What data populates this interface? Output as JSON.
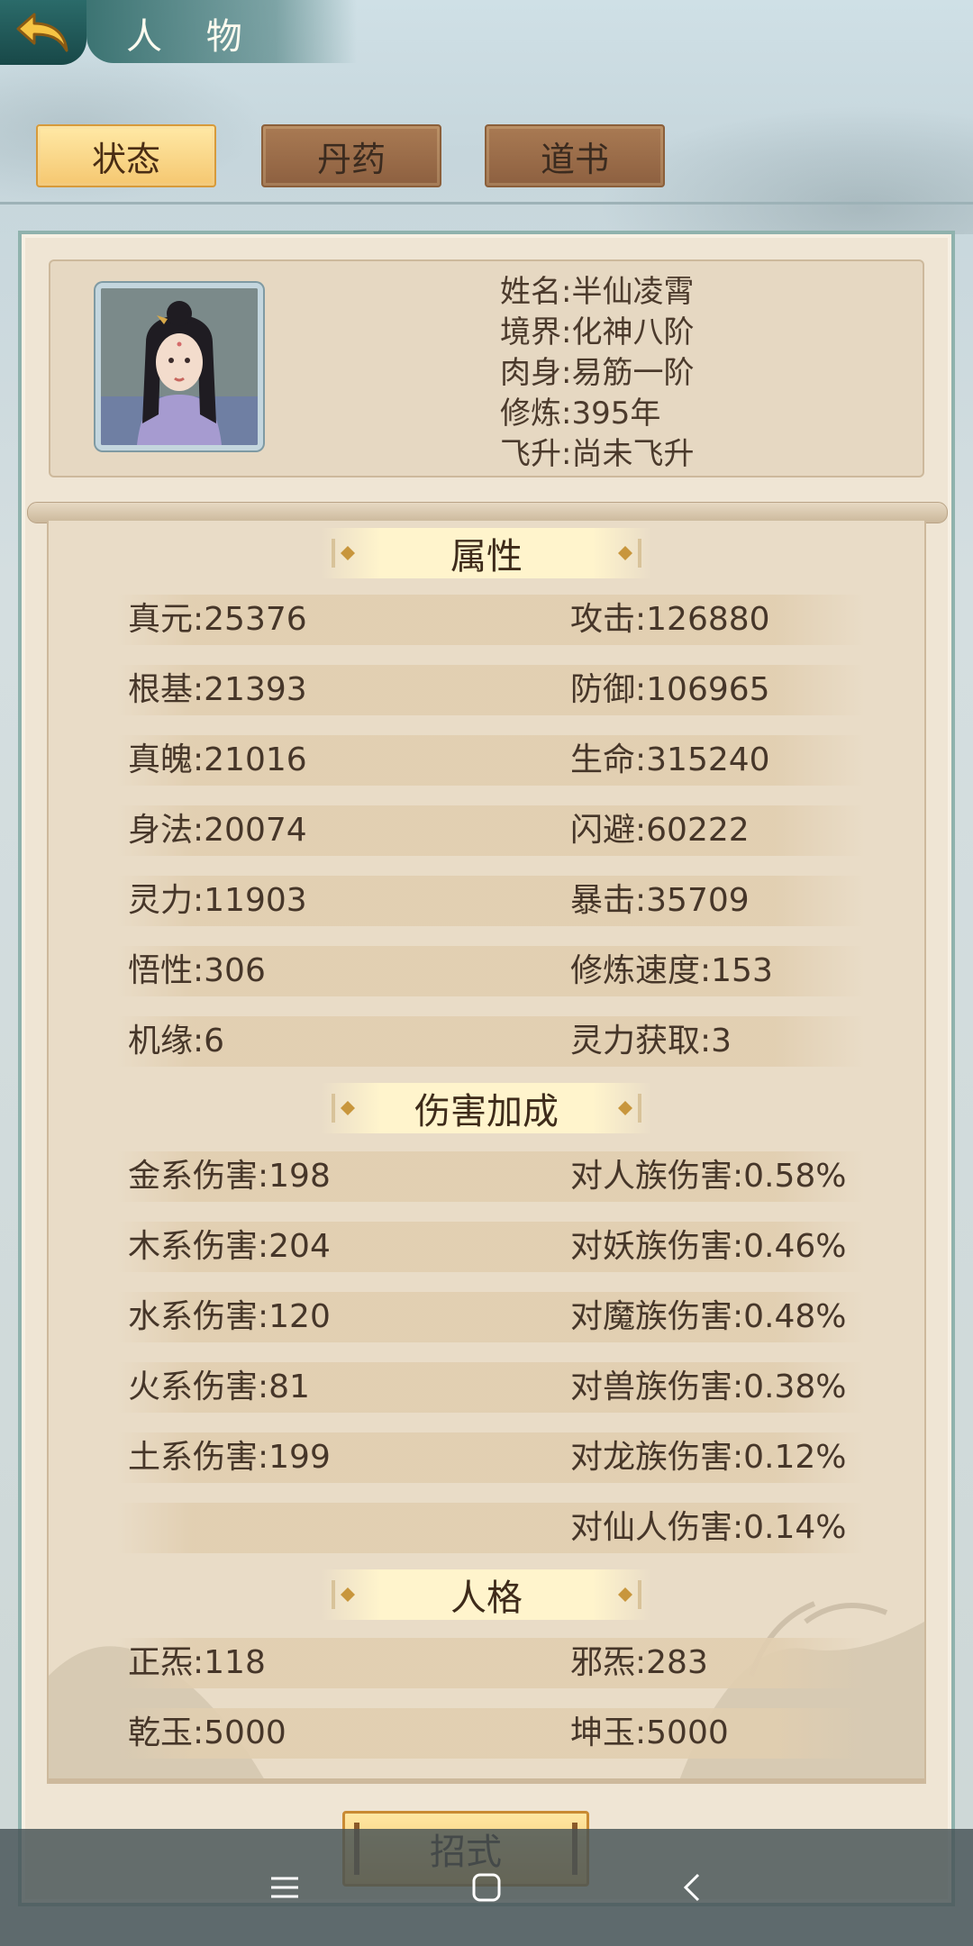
{
  "header": {
    "title": "人 物",
    "back_icon": "back-arrow-icon"
  },
  "tabs": [
    {
      "label": "状态",
      "active": true
    },
    {
      "label": "丹药",
      "active": false
    },
    {
      "label": "道书",
      "active": false
    }
  ],
  "profile": {
    "name": "姓名:半仙凌霄",
    "realm": "境界:化神八阶",
    "body": "肉身:易筋一阶",
    "cultivation": "修炼:395年",
    "ascension": "飞升:尚未飞升"
  },
  "sections": {
    "attributes": {
      "title": "属性",
      "rows": [
        {
          "left": "真元:25376",
          "right": "攻击:126880"
        },
        {
          "left": "根基:21393",
          "right": "防御:106965"
        },
        {
          "left": "真魄:21016",
          "right": "生命:315240"
        },
        {
          "left": "身法:20074",
          "right": "闪避:60222"
        },
        {
          "left": "灵力:11903",
          "right": "暴击:35709"
        },
        {
          "left": "悟性:306",
          "right": "修炼速度:153"
        },
        {
          "left": "机缘:6",
          "right": "灵力获取:3"
        }
      ]
    },
    "damage": {
      "title": "伤害加成",
      "rows": [
        {
          "left": "金系伤害:198",
          "right": "对人族伤害:0.58%"
        },
        {
          "left": "木系伤害:204",
          "right": "对妖族伤害:0.46%"
        },
        {
          "left": "水系伤害:120",
          "right": "对魔族伤害:0.48%"
        },
        {
          "left": "火系伤害:81",
          "right": "对兽族伤害:0.38%"
        },
        {
          "left": "土系伤害:199",
          "right": "对龙族伤害:0.12%"
        },
        {
          "left": "",
          "right": "对仙人伤害:0.14%"
        }
      ]
    },
    "personality": {
      "title": "人格",
      "rows": [
        {
          "left": "正炁:118",
          "right": "邪炁:283"
        },
        {
          "left": "乾玉:5000",
          "right": "坤玉:5000"
        }
      ]
    }
  },
  "bottom_button": {
    "label": "招式"
  },
  "navbar": {
    "icons": [
      "menu-icon",
      "home-square-icon",
      "back-chevron-icon"
    ]
  },
  "colors": {
    "active_tab": "#f5c770",
    "tab": "#8d6040",
    "panel": "#efe5d4",
    "teal": "#2b6b6a"
  }
}
